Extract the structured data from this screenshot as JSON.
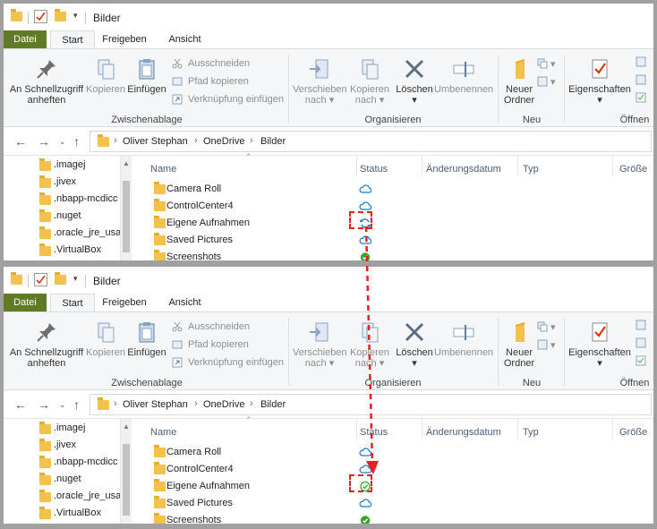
{
  "window": {
    "title": "Bilder"
  },
  "tabs": [
    "Datei",
    "Start",
    "Freigeben",
    "Ansicht"
  ],
  "ribbon": {
    "pin_label": "An Schnellzugriff anheften",
    "copy_label": "Kopieren",
    "paste_label": "Einfügen",
    "cut_label": "Ausschneiden",
    "copy_path_label": "Pfad kopieren",
    "paste_shortcut_label": "Verknüpfung einfügen",
    "group_clipboard": "Zwischenablage",
    "move_to_label": "Verschieben nach",
    "copy_to_label": "Kopieren nach",
    "delete_label": "Löschen",
    "rename_label": "Umbenennen",
    "group_organize": "Organisieren",
    "new_folder_label": "Neuer Ordner",
    "group_new": "Neu",
    "properties_label": "Eigenschaften",
    "group_open": "Öffnen"
  },
  "address": {
    "crumbs": [
      "Oliver Stephan",
      "OneDrive",
      "Bilder"
    ]
  },
  "nav_items": [
    ".imagej",
    ".jivex",
    ".nbapp-mcdicc",
    ".nuget",
    ".oracle_jre_usag",
    ".VirtualBox"
  ],
  "columns": {
    "name": "Name",
    "status": "Status",
    "date": "Änderungsdatum",
    "type": "Typ",
    "size": "Größe"
  },
  "files_before": [
    {
      "name": "Camera Roll",
      "status": "cloud"
    },
    {
      "name": "ControlCenter4",
      "status": "cloud"
    },
    {
      "name": "Eigene Aufnahmen",
      "status": "syncing"
    },
    {
      "name": "Saved Pictures",
      "status": "cloud"
    },
    {
      "name": "Screenshots",
      "status": "available"
    }
  ],
  "files_after": [
    {
      "name": "Camera Roll",
      "status": "cloud"
    },
    {
      "name": "ControlCenter4",
      "status": "cloud"
    },
    {
      "name": "Eigene Aufnahmen",
      "status": "local"
    },
    {
      "name": "Saved Pictures",
      "status": "cloud"
    },
    {
      "name": "Screenshots",
      "status": "available"
    }
  ],
  "colors": {
    "datei_tab": "#617a27",
    "folder": "#f3c24d",
    "cloud": "#1b7ad1",
    "available": "#35a52b",
    "marker": "#e62020"
  }
}
